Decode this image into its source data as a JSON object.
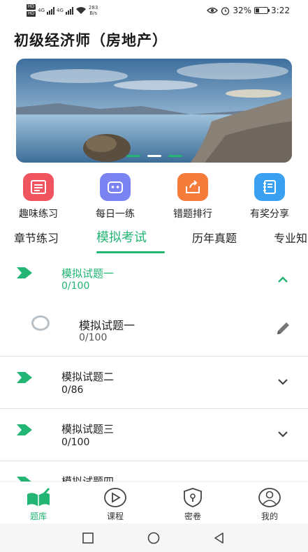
{
  "status_bar": {
    "sim1": "HD",
    "sim2": "HD",
    "net1": "4G",
    "net2": "4G",
    "net_speed_value": "283",
    "net_speed_unit": "B/s",
    "battery": "32%",
    "battery_level": 0.32,
    "time": "3:22"
  },
  "app": {
    "title": "初级经济师（房地产）"
  },
  "banner": {
    "slide_count": 3,
    "active_slide": 2
  },
  "quick_actions": [
    {
      "label": "趣味练习",
      "icon": "checklist-icon",
      "color": "#f0555f"
    },
    {
      "label": "每日一练",
      "icon": "robot-icon",
      "color": "#7b82f2"
    },
    {
      "label": "错题排行",
      "icon": "export-box-icon",
      "color": "#f57c3b"
    },
    {
      "label": "有奖分享",
      "icon": "notebook-icon",
      "color": "#3aa0f2"
    }
  ],
  "tabs": [
    {
      "label": "章节练习",
      "active": false
    },
    {
      "label": "模拟考试",
      "active": true
    },
    {
      "label": "历年真题",
      "active": false
    },
    {
      "label": "专业知",
      "active": false
    }
  ],
  "exam_groups": [
    {
      "title": "模拟试题一",
      "progress": "0/100",
      "expanded": true,
      "items": [
        {
          "title": "模拟试题一",
          "progress": "0/100"
        }
      ]
    },
    {
      "title": "模拟试题二",
      "progress": "0/86",
      "expanded": false
    },
    {
      "title": "模拟试题三",
      "progress": "0/100",
      "expanded": false
    },
    {
      "title": "模拟试题四",
      "progress": "",
      "expanded": false
    }
  ],
  "bottom_nav": [
    {
      "label": "题库",
      "icon": "book-icon",
      "active": true
    },
    {
      "label": "课程",
      "icon": "play-circle-icon",
      "active": false
    },
    {
      "label": "密卷",
      "icon": "lock-shield-icon",
      "active": false
    },
    {
      "label": "我的",
      "icon": "user-circle-icon",
      "active": false
    }
  ],
  "colors": {
    "accent": "#22b573",
    "text": "#222222",
    "divider": "#e4e4e4"
  }
}
